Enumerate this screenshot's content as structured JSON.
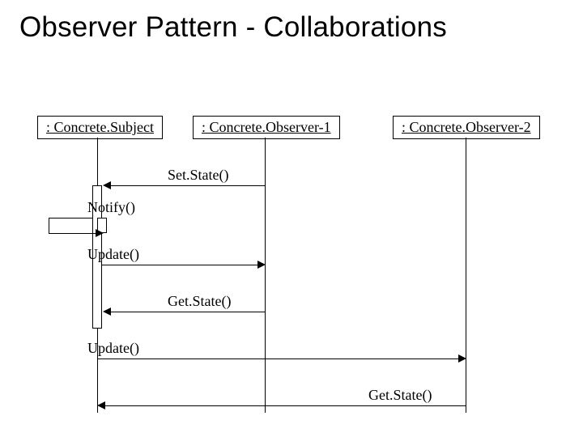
{
  "title": "Observer Pattern - Collaborations",
  "lifelines": {
    "subject": ": Concrete.Subject",
    "observer1": ": Concrete.Observer-1",
    "observer2": ": Concrete.Observer-2"
  },
  "messages": {
    "setstate": "Set.State()",
    "notify": "Notify()",
    "update1": "Update()",
    "getstate1": "Get.State()",
    "update2": "Update()",
    "getstate2": "Get.State()"
  }
}
